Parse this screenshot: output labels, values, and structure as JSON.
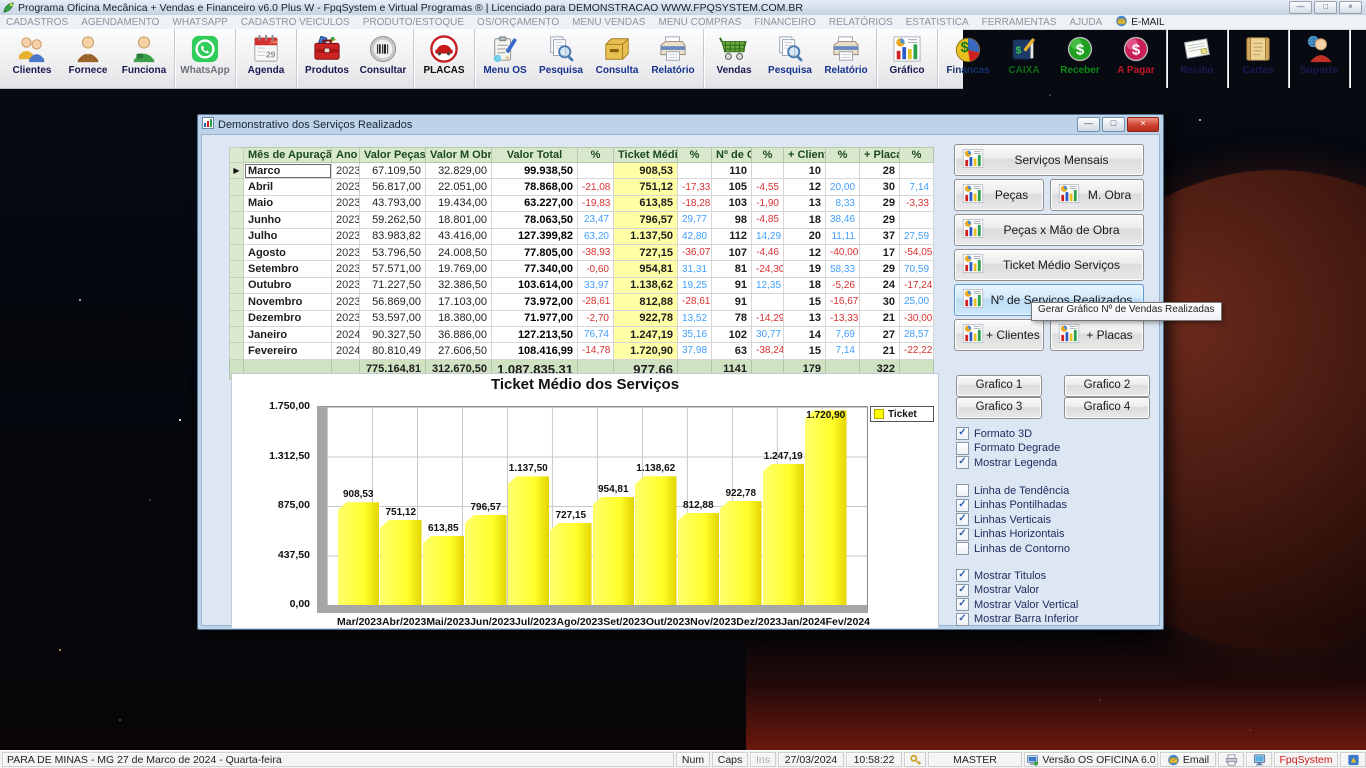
{
  "app": {
    "title": "Programa Oficina Mecânica + Vendas e Financeiro v6.0 Plus W - FpqSystem e Virtual Programas ® | Licenciado para  DEMONSTRACAO WWW.FPQSYSTEM.COM.BR",
    "window_controls": [
      "minimize",
      "restore",
      "close"
    ]
  },
  "menu": {
    "items": [
      "CADASTROS",
      "AGENDAMENTO",
      "WHATSAPP",
      "CADASTRO VEICULOS",
      "PRODUTO/ESTOQUE",
      "OS/ORÇAMENTO",
      "MENU VENDAS",
      "MENU COMPRAS",
      "FINANCEIRO",
      "RELATÓRIOS",
      "ESTATISTICA",
      "FERRAMENTAS",
      "AJUDA"
    ],
    "email_item": "E-MAIL"
  },
  "toolbar": {
    "groups": [
      [
        {
          "label": "Clientes",
          "icon": "clients"
        },
        {
          "label": "Fornece",
          "icon": "supplier"
        },
        {
          "label": "Funciona",
          "icon": "employee"
        }
      ],
      [
        {
          "label": "WhatsApp",
          "icon": "whatsapp",
          "label_color": "#6d7278"
        }
      ],
      [
        {
          "label": "Agenda",
          "icon": "calendar"
        }
      ],
      [
        {
          "label": "Produtos",
          "icon": "toolbox"
        },
        {
          "label": "Consultar",
          "icon": "barcode"
        }
      ],
      [
        {
          "label": "PLACAS",
          "icon": "car",
          "label_color": "#0c0c0c"
        }
      ],
      [
        {
          "label": "Menu OS",
          "icon": "clipboard",
          "label_color": "#16328c"
        },
        {
          "label": "Pesquisa",
          "icon": "searchpages",
          "label_color": "#16328c"
        },
        {
          "label": "Consulta",
          "icon": "drawer",
          "label_color": "#16328c"
        },
        {
          "label": "Relatório",
          "icon": "printer",
          "label_color": "#16328c"
        }
      ],
      [
        {
          "label": "Vendas",
          "icon": "cart"
        },
        {
          "label": "Pesquisa",
          "icon": "searchpages",
          "label_color": "#16328c"
        },
        {
          "label": "Relatório",
          "icon": "printer",
          "label_color": "#16328c"
        }
      ],
      [
        {
          "label": "Gráfico",
          "icon": "chart"
        }
      ],
      [
        {
          "label": "Financas",
          "icon": "pie",
          "label_color": "#14326e"
        },
        {
          "label": "CAIXA",
          "icon": "book",
          "label_color": "#0c6b14"
        },
        {
          "label": "Receber",
          "icon": "coin-green",
          "label_color": "#0c8a14"
        },
        {
          "label": "A Pagar",
          "icon": "coin-red",
          "label_color": "#c01828"
        }
      ],
      [
        {
          "label": "Recibo",
          "icon": "receipt"
        }
      ],
      [
        {
          "label": "Cartas",
          "icon": "scroll"
        }
      ],
      [
        {
          "label": "Suporte",
          "icon": "support"
        }
      ],
      [
        {
          "label": "",
          "icon": "exit"
        }
      ]
    ]
  },
  "dialog": {
    "title": "Demonstrativo dos Serviços Realizados",
    "window_controls": [
      "minimize",
      "maximize",
      "close"
    ],
    "table": {
      "headers": [
        "Mês de Apuração",
        "Ano",
        "Valor Peças",
        "Valor M Obra",
        "Valor Total",
        "%",
        "Ticket Médio",
        "%",
        "Nº de OS",
        "%",
        "+ Clientes",
        "%",
        "+ Placas",
        "%"
      ],
      "rows": [
        [
          "Marco",
          "2023",
          "67.109,50",
          "32.829,00",
          "99.938,50",
          "",
          "908,53",
          "",
          "110",
          "",
          "10",
          "",
          "28",
          ""
        ],
        [
          "Abril",
          "2023",
          "56.817,00",
          "22.051,00",
          "78.868,00",
          "-21,08",
          "751,12",
          "-17,33",
          "105",
          "-4,55",
          "12",
          "20,00",
          "30",
          "7,14"
        ],
        [
          "Maio",
          "2023",
          "43.793,00",
          "19.434,00",
          "63.227,00",
          "-19,83",
          "613,85",
          "-18,28",
          "103",
          "-1,90",
          "13",
          "8,33",
          "29",
          "-3,33"
        ],
        [
          "Junho",
          "2023",
          "59.262,50",
          "18.801,00",
          "78.063,50",
          "23,47",
          "796,57",
          "29,77",
          "98",
          "-4,85",
          "18",
          "38,46",
          "29",
          ""
        ],
        [
          "Julho",
          "2023",
          "83.983,82",
          "43.416,00",
          "127.399,82",
          "63,20",
          "1.137,50",
          "42,80",
          "112",
          "14,29",
          "20",
          "11,11",
          "37",
          "27,59"
        ],
        [
          "Agosto",
          "2023",
          "53.796,50",
          "24.008,50",
          "77.805,00",
          "-38,93",
          "727,15",
          "-36,07",
          "107",
          "-4,46",
          "12",
          "-40,00",
          "17",
          "-54,05"
        ],
        [
          "Setembro",
          "2023",
          "57.571,00",
          "19.769,00",
          "77.340,00",
          "-0,60",
          "954,81",
          "31,31",
          "81",
          "-24,30",
          "19",
          "58,33",
          "29",
          "70,59"
        ],
        [
          "Outubro",
          "2023",
          "71.227,50",
          "32.386,50",
          "103.614,00",
          "33,97",
          "1.138,62",
          "19,25",
          "91",
          "12,35",
          "18",
          "-5,26",
          "24",
          "-17,24"
        ],
        [
          "Novembro",
          "2023",
          "56.869,00",
          "17.103,00",
          "73.972,00",
          "-28,61",
          "812,88",
          "-28,61",
          "91",
          "",
          "15",
          "-16,67",
          "30",
          "25,00"
        ],
        [
          "Dezembro",
          "2023",
          "53.597,00",
          "18.380,00",
          "71.977,00",
          "-2,70",
          "922,78",
          "13,52",
          "78",
          "-14,29",
          "13",
          "-13,33",
          "21",
          "-30,00"
        ],
        [
          "Janeiro",
          "2024",
          "90.327,50",
          "36.886,00",
          "127.213,50",
          "76,74",
          "1.247,19",
          "35,16",
          "102",
          "30,77",
          "14",
          "7,69",
          "27",
          "28,57"
        ],
        [
          "Fevereiro",
          "2024",
          "80.810,49",
          "27.606,50",
          "108.416,99",
          "-14,78",
          "1.720,90",
          "37,98",
          "63",
          "-38,24",
          "15",
          "7,14",
          "21",
          "-22,22"
        ]
      ],
      "totals": [
        "",
        "",
        "775.164,81",
        "312.670,50",
        "1.087.835,31",
        "",
        "977,66",
        "",
        "1141",
        "",
        "179",
        "",
        "322",
        ""
      ]
    },
    "side_panel": {
      "chart_buttons": [
        {
          "label": "Serviços Mensais",
          "layout": "full"
        },
        {
          "label": "Peças",
          "layout": "half-left"
        },
        {
          "label": "M. Obra",
          "layout": "half-right"
        },
        {
          "label": "Peças x Mão de Obra",
          "layout": "full"
        },
        {
          "label": "Ticket Médio Serviços",
          "layout": "full"
        },
        {
          "label": "Nº de Serviços Realizados",
          "layout": "full",
          "active": true
        },
        {
          "label": "+ Clientes",
          "layout": "half-left"
        },
        {
          "label": "+ Placas",
          "layout": "half-right"
        }
      ],
      "tooltip": "Gerar Gráfico Nº de Vendas Realizadas",
      "grafico_buttons": [
        "Grafico 1",
        "Grafico 2",
        "Grafico 3",
        "Grafico 4"
      ],
      "checkbox_groups": [
        [
          {
            "label": "Formato 3D",
            "checked": true
          },
          {
            "label": "Formato Degrade",
            "checked": false
          },
          {
            "label": "Mostrar Legenda",
            "checked": true
          }
        ],
        [
          {
            "label": "Linha de Tendência",
            "checked": false
          },
          {
            "label": "Linhas Pontilhadas",
            "checked": true
          },
          {
            "label": "Linhas Verticais",
            "checked": true
          },
          {
            "label": "Linhas Horizontais",
            "checked": true
          },
          {
            "label": "Linhas de Contorno",
            "checked": false
          }
        ],
        [
          {
            "label": "Mostrar Titulos",
            "checked": true
          },
          {
            "label": "Mostrar Valor",
            "checked": true
          },
          {
            "label": "Mostrar Valor Vertical",
            "checked": true
          },
          {
            "label": "Mostrar Barra Inferior",
            "checked": true
          }
        ]
      ]
    }
  },
  "chart_data": {
    "type": "bar",
    "title": "Ticket Médio dos Serviços",
    "categories": [
      "Mar/2023",
      "Abr/2023",
      "Mai/2023",
      "Jun/2023",
      "Jul/2023",
      "Ago/2023",
      "Set/2023",
      "Out/2023",
      "Nov/2023",
      "Dez/2023",
      "Jan/2024",
      "Fev/2024"
    ],
    "values": [
      908.53,
      751.12,
      613.85,
      796.57,
      1137.5,
      727.15,
      954.81,
      1138.62,
      812.88,
      922.78,
      1247.19,
      1720.9
    ],
    "value_labels": [
      "908,53",
      "751,12",
      "613,85",
      "796,57",
      "1.137,50",
      "727,15",
      "954,81",
      "1.138,62",
      "812,88",
      "922,78",
      "1.247,19",
      "1.720,90"
    ],
    "ylim": [
      0,
      1750
    ],
    "yticks": [
      "1.750,00",
      "1.312,50",
      "875,00",
      "437,50",
      "0,00"
    ],
    "legend": [
      "Ticket"
    ],
    "legend_position": "top-right",
    "bar_color": "#ffff33",
    "grid": true
  },
  "colors": {
    "positive_pct": "#3f9fff",
    "negative_pct": "#d83030",
    "ticket_column_bg": "#ffffa6",
    "header_green": "#d8e8cc",
    "bar_yellow": "#ffff33"
  },
  "statusbar": {
    "panels": [
      {
        "id": "location",
        "label": "PARA DE MINAS - MG 27 de Marco de 2024 - Quarta-feira"
      },
      {
        "id": "num",
        "label": "Num"
      },
      {
        "id": "caps",
        "label": "Caps"
      },
      {
        "id": "ins",
        "label": "Ins"
      },
      {
        "id": "date",
        "label": "27/03/2024"
      },
      {
        "id": "time",
        "label": "10:58:22"
      },
      {
        "id": "key",
        "icon": "key"
      },
      {
        "id": "user",
        "label": "MASTER"
      },
      {
        "id": "version",
        "icon": "pc",
        "label": "Versão OS OFICINA 6.0"
      },
      {
        "id": "email",
        "icon": "mail",
        "label": "Email"
      },
      {
        "id": "printer",
        "icon": "printer-sm"
      },
      {
        "id": "network",
        "icon": "monitor"
      },
      {
        "id": "brand",
        "label": "FpqSystem"
      },
      {
        "id": "app",
        "icon": "fpq"
      }
    ]
  }
}
